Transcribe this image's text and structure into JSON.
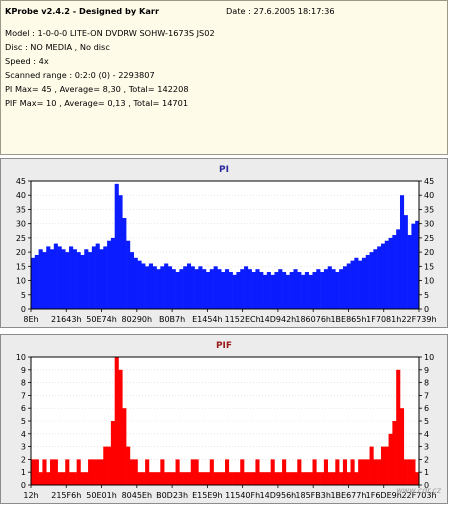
{
  "info": {
    "title": "KProbe v2.4.2 - Designed by Karr",
    "date": "Date : 27.6.2005 18:17:36",
    "lines": [
      "Model : 1-0-0-0 LITE-ON DVDRW SOHW-1673S JS02",
      "Disc : NO MEDIA , No disc",
      "Speed : 4x",
      "Scanned range : 0:2:0 (0) - 2293807",
      "PI Max= 45 , Average= 8,30 , Total= 142208",
      "PIF Max= 10 , Average= 0,13 , Total= 14701"
    ]
  },
  "watermark": "www.cdr.cz",
  "colors": {
    "pi": "#0b1cff",
    "pif": "#ff0000",
    "frame": "#000000",
    "panel": "#ececec",
    "plot": "#ffffff",
    "grid": "#d9d9d9"
  },
  "chart_data": [
    {
      "type": "bar",
      "title": "PI",
      "ylim": [
        0,
        45
      ],
      "ytick_step": 5,
      "x_tick_labels": [
        "8Eh",
        "21643h",
        "50E74h",
        "80290h",
        "B0B7h",
        "E1454h",
        "1152ECh",
        "14D942h",
        "186076h",
        "1BE865h",
        "1F7081h",
        "22F739h"
      ],
      "series": [
        {
          "values": [
            18,
            19,
            21,
            20,
            22,
            21,
            23,
            22,
            21,
            20,
            22,
            21,
            20,
            19,
            21,
            20,
            22,
            23,
            21,
            22,
            24,
            25,
            44,
            40,
            32,
            24,
            20,
            18,
            17,
            16,
            15,
            16,
            15,
            14,
            15,
            16,
            15,
            14,
            13,
            14,
            15,
            16,
            15,
            14,
            15,
            14,
            13,
            14,
            15,
            14,
            13,
            14,
            13,
            12,
            13,
            14,
            15,
            14,
            13,
            14,
            13,
            12,
            13,
            12,
            13,
            14,
            13,
            12,
            13,
            14,
            13,
            12,
            13,
            12,
            13,
            14,
            13,
            14,
            15,
            14,
            13,
            14,
            15,
            16,
            17,
            18,
            17,
            18,
            19,
            20,
            21,
            22,
            23,
            24,
            25,
            26,
            28,
            40,
            33,
            26,
            30,
            31
          ],
          "peak_indices": [
            22,
            98
          ]
        }
      ]
    },
    {
      "type": "bar",
      "title": "PIF",
      "ylim": [
        0,
        10
      ],
      "ytick_step": 1,
      "x_tick_labels": [
        "12h",
        "215F6h",
        "50E01h",
        "8045Eh",
        "B0D23h",
        "E15E9h",
        "11540Fh",
        "14D956h",
        "185FB3h",
        "1BE677h",
        "1F6DE9h",
        "22F703h"
      ],
      "series": [
        {
          "values": [
            2,
            2,
            1,
            2,
            1,
            2,
            2,
            1,
            1,
            2,
            1,
            1,
            2,
            1,
            1,
            2,
            2,
            2,
            2,
            3,
            3,
            5,
            10,
            9,
            6,
            3,
            2,
            2,
            1,
            1,
            2,
            1,
            1,
            1,
            2,
            1,
            1,
            1,
            2,
            1,
            1,
            1,
            2,
            2,
            1,
            1,
            1,
            2,
            1,
            1,
            1,
            2,
            1,
            1,
            1,
            2,
            1,
            1,
            1,
            2,
            1,
            1,
            1,
            2,
            1,
            1,
            2,
            1,
            1,
            1,
            2,
            1,
            1,
            1,
            2,
            1,
            1,
            2,
            1,
            1,
            2,
            1,
            2,
            1,
            2,
            1,
            2,
            2,
            2,
            3,
            2,
            2,
            3,
            3,
            4,
            5,
            9,
            6,
            2,
            2,
            2,
            1
          ],
          "peak_indices": [
            22,
            96
          ]
        }
      ]
    }
  ]
}
